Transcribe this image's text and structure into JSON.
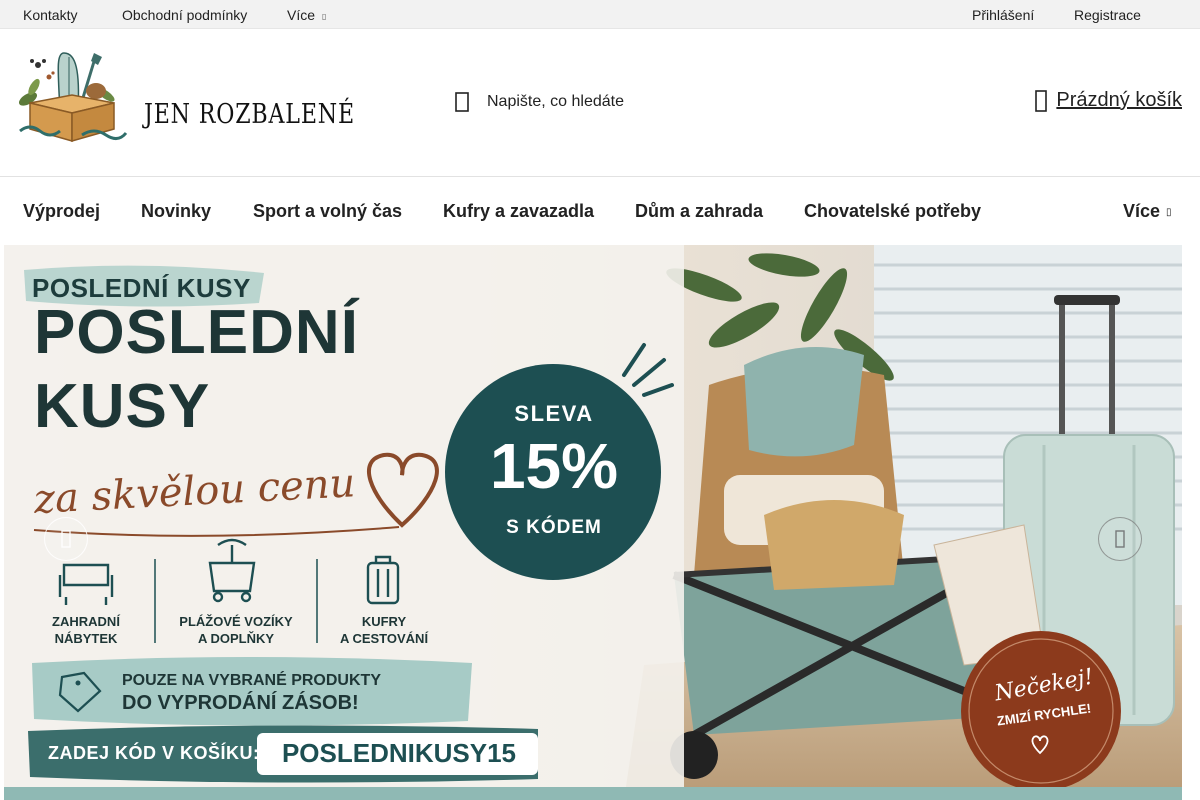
{
  "topbar": {
    "links": [
      "Kontakty",
      "Obchodní podmínky",
      "Více"
    ],
    "login": "Přihlášení",
    "register": "Registrace",
    "more_caret": "▯"
  },
  "header": {
    "logo_text": "JEN ROZBALENÉ",
    "search_placeholder": "Napište, co hledáte",
    "cart_label": "Prázdný košík"
  },
  "nav": {
    "items": [
      "Výprodej",
      "Novinky",
      "Sport a volný čas",
      "Kufry a zavazadla",
      "Dům a zahrada",
      "Chovatelské potřeby"
    ],
    "more": "Více",
    "more_caret": "▯"
  },
  "hero": {
    "eyebrow": "POSLEDNÍ KUSY",
    "headline_line1": "POSLEDNÍ",
    "headline_line2": "KUSY",
    "script": "za skvělou cenu",
    "badge_top": "SLEVA",
    "badge_value": "15%",
    "badge_bottom": "S KÓDEM",
    "categories": [
      {
        "line1": "ZAHRADNÍ",
        "line2": "NÁBYTEK"
      },
      {
        "line1": "PLÁŽOVÉ VOZÍKY",
        "line2": "A DOPLŇKY"
      },
      {
        "line1": "KUFRY",
        "line2": "A CESTOVÁNÍ"
      }
    ],
    "notice_line1": "POUZE NA VYBRANÉ PRODUKTY",
    "notice_line2": "DO VYPRODÁNÍ ZÁSOB!",
    "code_label": "ZADEJ KÓD V KOŠÍKU:",
    "code_value": "POSLEDNIKUSY15",
    "stamp_line1": "Nečekej!",
    "stamp_line2": "ZMIZÍ RYCHLE!"
  },
  "colors": {
    "teal_dark": "#1d4f52",
    "teal_light": "#9cc6c2",
    "brown_script": "#8a4a2a",
    "stamp": "#8c3a1c"
  }
}
